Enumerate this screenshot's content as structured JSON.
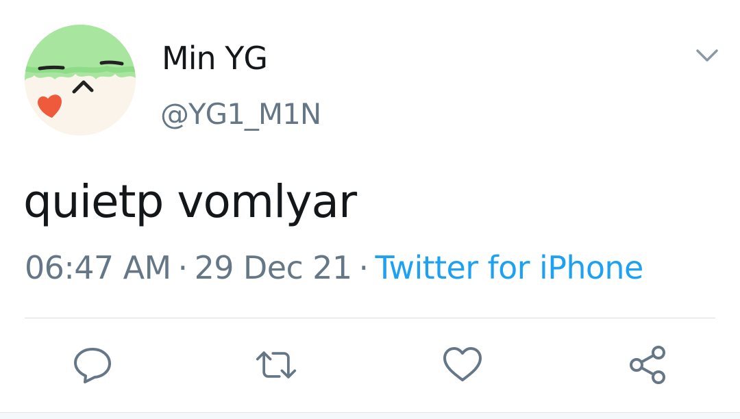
{
  "tweet": {
    "display_name": "Min YG",
    "handle": "@YG1_M1N",
    "text": "quietp vomlyar",
    "time": "06:47 AM",
    "separator": "·",
    "date": "29 Dec 21",
    "source": "Twitter for iPhone"
  },
  "icons": {
    "menu": "chevron-down-icon",
    "reply": "reply-icon",
    "retweet": "retweet-icon",
    "like": "heart-icon",
    "share": "share-icon"
  },
  "colors": {
    "text_primary": "#14171a",
    "text_secondary": "#657786",
    "accent": "#1da1f2",
    "icon": "#657786"
  }
}
